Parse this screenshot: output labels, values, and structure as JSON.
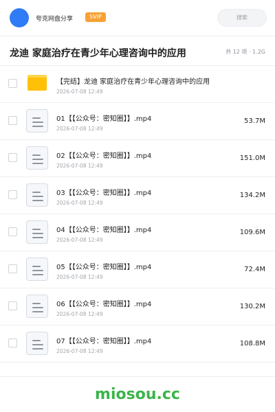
{
  "header": {
    "share_name": "夸克网盘分享",
    "badge": "SVIP",
    "search_placeholder": "搜索",
    "accent": "#2f7cf6",
    "badge_color": "#f7a134"
  },
  "folder": {
    "title": "龙迪 家庭治疗在青少年心理咨询中的应用",
    "summary": "共 12 项 · 1.2G"
  },
  "items": [
    {
      "type": "folder",
      "name": "【完结】龙迪 家庭治疗在青少年心理咨询中的应用",
      "date": "2026-07-08 12:49",
      "size": ""
    },
    {
      "type": "file",
      "name": "01【【公众号：密知圈】】.mp4",
      "date": "2026-07-08 12:49",
      "size": "53.7M"
    },
    {
      "type": "file",
      "name": "02【【公众号：密知圈】】.mp4",
      "date": "2026-07-08 12:49",
      "size": "151.0M"
    },
    {
      "type": "file",
      "name": "03【【公众号：密知圈】】.mp4",
      "date": "2026-07-08 12:49",
      "size": "134.2M"
    },
    {
      "type": "file",
      "name": "04【【公众号：密知圈】】.mp4",
      "date": "2026-07-08 12:49",
      "size": "109.6M"
    },
    {
      "type": "file",
      "name": "05【【公众号：密知圈】】.mp4",
      "date": "2026-07-08 12:49",
      "size": "72.4M"
    },
    {
      "type": "file",
      "name": "06【【公众号：密知圈】】.mp4",
      "date": "2026-07-08 12:49",
      "size": "130.2M"
    },
    {
      "type": "file",
      "name": "07【【公众号：密知圈】】.mp4",
      "date": "2026-07-08 12:49",
      "size": "108.8M"
    }
  ],
  "watermark": {
    "text": "miosou.cc",
    "color": "#3bb44a"
  }
}
